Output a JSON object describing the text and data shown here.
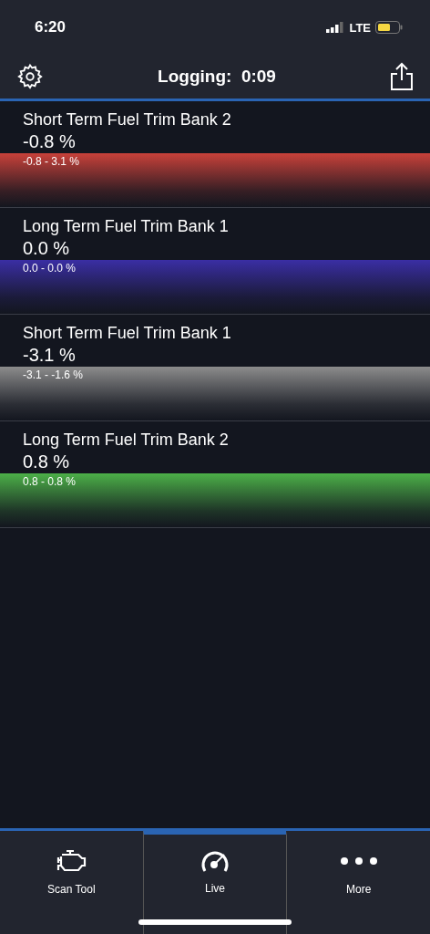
{
  "status_bar": {
    "time": "6:20",
    "network": "LTE"
  },
  "header": {
    "title": "Logging:  0:09"
  },
  "gauges": [
    {
      "name": "Short Term Fuel Trim Bank 2",
      "value": "-0.8 %",
      "range": "-0.8 - 3.1 %",
      "color": "#c8413a"
    },
    {
      "name": "Long Term Fuel Trim Bank 1",
      "value": "0.0 %",
      "range": "0.0 - 0.0 %",
      "color": "#3a2ea4"
    },
    {
      "name": "Short Term Fuel Trim Bank 1",
      "value": "-3.1 %",
      "range": "-3.1 - -1.6 %",
      "color": "#8c8c8c"
    },
    {
      "name": "Long Term Fuel Trim Bank 2",
      "value": "0.8 %",
      "range": "0.8 - 0.8 %",
      "color": "#4cb048"
    }
  ],
  "tabs": [
    {
      "kind": "engine",
      "label": "Scan Tool",
      "selected": false
    },
    {
      "kind": "gauge",
      "label": "Live",
      "selected": true
    },
    {
      "kind": "more",
      "label": "More",
      "selected": false
    }
  ]
}
